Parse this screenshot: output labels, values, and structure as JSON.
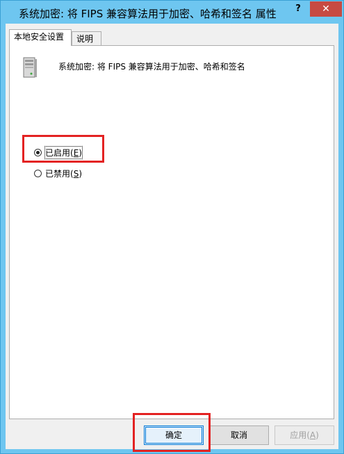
{
  "window": {
    "title": "系统加密: 将 FIPS 兼容算法用于加密、哈希和签名 属性",
    "help_label": "?",
    "close_label": "✕"
  },
  "tabs": [
    {
      "label": "本地安全设置",
      "selected": true
    },
    {
      "label": "说明",
      "selected": false
    }
  ],
  "policy": {
    "icon": "server-computer-icon",
    "title": "系统加密: 将 FIPS 兼容算法用于加密、哈希和签名"
  },
  "options": {
    "enabled": {
      "label": "已启用(",
      "hotkey": "E",
      "suffix": ")",
      "checked": true
    },
    "disabled": {
      "label": "已禁用(",
      "hotkey": "S",
      "suffix": ")",
      "checked": false
    }
  },
  "buttons": {
    "ok_label": "确定",
    "cancel_label": "取消",
    "apply_label": "应用(",
    "apply_hotkey": "A",
    "apply_suffix": ")"
  },
  "colors": {
    "highlight_box": "#e32222",
    "title_bar": "#6ec6f0",
    "close_button": "#c74a42"
  }
}
